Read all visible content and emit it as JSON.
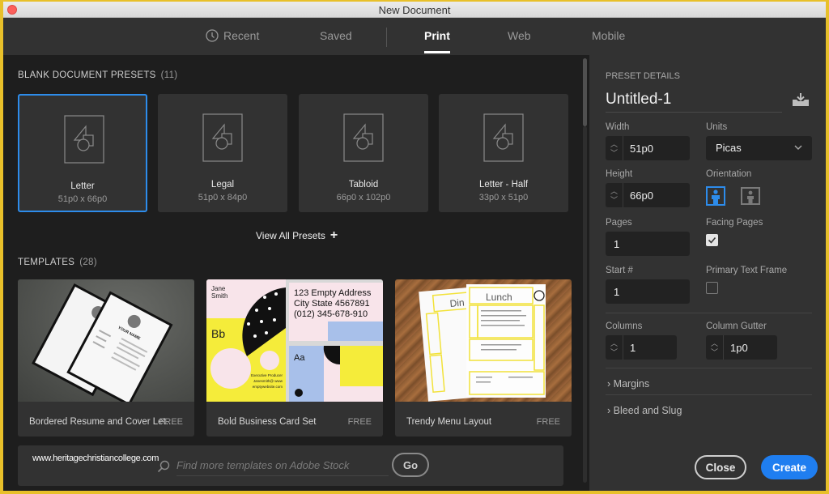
{
  "window": {
    "title": "New Document"
  },
  "tabs": [
    {
      "label": "Recent",
      "icon": "clock-icon",
      "active": false
    },
    {
      "label": "Saved",
      "active": false
    },
    {
      "label": "Print",
      "active": true
    },
    {
      "label": "Web",
      "active": false
    },
    {
      "label": "Mobile",
      "active": false
    }
  ],
  "presets": {
    "heading": "BLANK DOCUMENT PRESETS",
    "count": "(11)",
    "items": [
      {
        "name": "Letter",
        "size": "51p0 x 66p0",
        "selected": true
      },
      {
        "name": "Legal",
        "size": "51p0 x 84p0",
        "selected": false
      },
      {
        "name": "Tabloid",
        "size": "66p0 x 102p0",
        "selected": false
      },
      {
        "name": "Letter - Half",
        "size": "33p0 x 51p0",
        "selected": false
      }
    ],
    "view_all_label": "View All Presets",
    "view_all_icon": "plus-icon"
  },
  "templates": {
    "heading": "TEMPLATES",
    "count": "(28)",
    "items": [
      {
        "name": "Bordered Resume and Cover Let...",
        "price": "FREE",
        "thumb_text": {
          "heading": "YOUR NAME"
        }
      },
      {
        "name": "Bold Business Card Set",
        "price": "FREE",
        "thumb_text": {
          "name1": "Jane",
          "name2": "Smith",
          "bb": "Bb",
          "aa": "Aa",
          "addr1": "123 Empty Address",
          "addr2": "City State 4567891",
          "phone": "(012) 345-678-910",
          "role": "Executive Producer",
          "email": "Janesmith@ www",
          "site": "emptywebsite.com"
        }
      },
      {
        "name": "Trendy Menu Layout",
        "price": "FREE",
        "thumb_text": {
          "lunch": "Lunch",
          "dinner": "Din"
        }
      }
    ]
  },
  "stock_search": {
    "watermark": "www.heritagechristiancollege.com",
    "placeholder": "Find more templates on Adobe Stock",
    "value": "",
    "go_label": "Go"
  },
  "details": {
    "heading": "PRESET DETAILS",
    "doc_name": "Untitled-1",
    "width_label": "Width",
    "width_value": "51p0",
    "units_label": "Units",
    "units_value": "Picas",
    "height_label": "Height",
    "height_value": "66p0",
    "orientation_label": "Orientation",
    "orientation_value": "portrait",
    "pages_label": "Pages",
    "pages_value": "1",
    "facing_label": "Facing Pages",
    "facing_checked": true,
    "start_label": "Start #",
    "start_value": "1",
    "primary_label": "Primary Text Frame",
    "primary_checked": false,
    "columns_label": "Columns",
    "columns_value": "1",
    "gutter_label": "Column Gutter",
    "gutter_value": "1p0",
    "margins_label": "Margins",
    "bleed_label": "Bleed and Slug",
    "close_label": "Close",
    "create_label": "Create"
  },
  "colors": {
    "accent": "#2d8ceb",
    "create_button": "#1f7ef0",
    "panel": "#323232",
    "background": "#1e1e1e"
  }
}
